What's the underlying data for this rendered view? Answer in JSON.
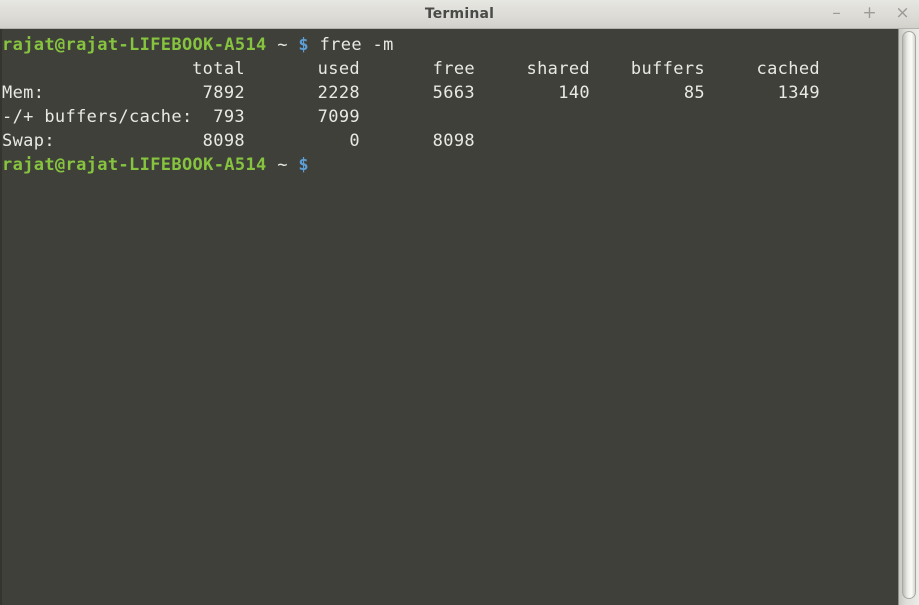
{
  "window": {
    "title": "Terminal",
    "controls": [
      {
        "name": "minimize-button",
        "glyph": "–"
      },
      {
        "name": "maximize-button",
        "glyph": "+"
      },
      {
        "name": "close-button",
        "glyph": "×"
      }
    ]
  },
  "colors": {
    "titlebar_bg": "#dddcd7",
    "title_text": "#4a4a48",
    "terminal_bg": "#3f4039",
    "terminal_fg": "#e8e8e4",
    "prompt_user": "#86c440",
    "prompt_dollar": "#5d9ed6",
    "scrollbar_track": "#dededa"
  },
  "terminal": {
    "prompt": {
      "user_host": "rajat@rajat-LIFEBOOK-A514",
      "path": "~",
      "symbol": "$"
    },
    "command": "free -m",
    "output": {
      "headers": [
        "total",
        "used",
        "free",
        "shared",
        "buffers",
        "cached"
      ],
      "rows": [
        {
          "label": "Mem:",
          "values": [
            "7892",
            "2228",
            "5663",
            "140",
            "85",
            "1349"
          ]
        },
        {
          "label": "-/+ buffers/cache:",
          "values": [
            "793",
            "7099",
            "",
            "",
            "",
            ""
          ]
        },
        {
          "label": "Swap:",
          "values": [
            "8098",
            "0",
            "8098",
            "",
            "",
            ""
          ]
        }
      ]
    }
  }
}
